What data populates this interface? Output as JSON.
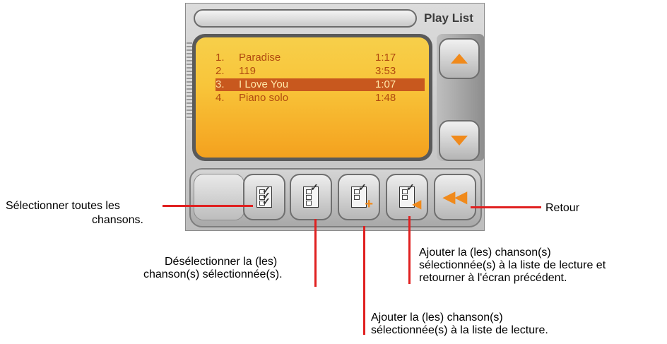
{
  "app": {
    "title": "Play List"
  },
  "playlist": [
    {
      "index": "1.",
      "name": "Paradise",
      "duration": "1:17"
    },
    {
      "index": "2.",
      "name": "119",
      "duration": "3:53"
    },
    {
      "index": "3.",
      "name": "I Love You",
      "duration": "1:07",
      "selected": true
    },
    {
      "index": "4.",
      "name": "Piano solo",
      "duration": "1:48"
    }
  ],
  "toolbar": {
    "buttons": [
      {
        "name": "select-all-button",
        "icon": "select-all-icon"
      },
      {
        "name": "deselect-button",
        "icon": "deselect-icon"
      },
      {
        "name": "add-to-playlist-button",
        "icon": "add-to-playlist-icon"
      },
      {
        "name": "add-and-return-button",
        "icon": "add-and-return-icon"
      },
      {
        "name": "back-button",
        "icon": "back-arrow-icon"
      }
    ]
  },
  "callouts": {
    "select_all": "Sélectionner toutes les chansons.",
    "deselect_line1": "Désélectionner la (les)",
    "deselect_line2": "chanson(s) sélectionnée(s).",
    "add_return_line1": "Ajouter la (les) chanson(s)",
    "add_return_line2": "sélectionnée(s) à la liste de lecture et",
    "add_return_line3": "retourner à l'écran précédent.",
    "add_line1": "Ajouter la (les) chanson(s)",
    "add_line2": "sélectionnée(s) à la liste de lecture.",
    "back": "Retour",
    "select_all_line1": "Sélectionner toutes les",
    "select_all_line2": "chansons."
  },
  "colors": {
    "accent": "#f08a1c",
    "callout_line": "#e02020",
    "selection": "#c8581e"
  }
}
